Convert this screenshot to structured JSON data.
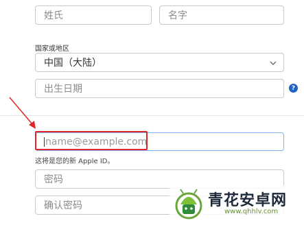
{
  "form": {
    "last_name_placeholder": "姓氏",
    "first_name_placeholder": "名字",
    "country_label": "国家或地区",
    "country_value": "中国（大陆）",
    "birthday_placeholder": "出生日期",
    "help_symbol": "?",
    "email_placeholder": "name@example.com",
    "email_hint": "这将是您的新 Apple ID。",
    "password_placeholder": "密码",
    "confirm_password_placeholder": "确认密码"
  },
  "annotation": {
    "arrow_color": "#e0252b",
    "box_color": "#e0252b"
  },
  "watermark": {
    "title": "青花安卓网",
    "url": "www.qhhlv.com"
  }
}
